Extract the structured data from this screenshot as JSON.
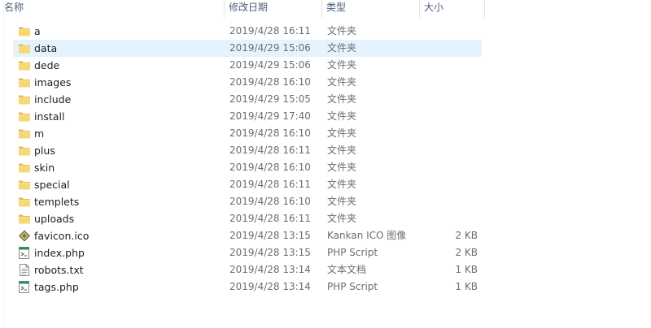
{
  "columns": {
    "name": "名称",
    "date": "修改日期",
    "type": "类型",
    "size": "大小"
  },
  "colors": {
    "selected_row": "#e5f3ff",
    "folder": "#f7d774",
    "header_text": "#4c607a"
  },
  "files": [
    {
      "name": "a",
      "date": "2019/4/28 16:11",
      "type": "文件夹",
      "size": "",
      "icon": "folder-icon"
    },
    {
      "name": "data",
      "date": "2019/4/29 15:06",
      "type": "文件夹",
      "size": "",
      "icon": "folder-icon",
      "selected": true
    },
    {
      "name": "dede",
      "date": "2019/4/29 15:06",
      "type": "文件夹",
      "size": "",
      "icon": "folder-icon"
    },
    {
      "name": "images",
      "date": "2019/4/28 16:10",
      "type": "文件夹",
      "size": "",
      "icon": "folder-icon"
    },
    {
      "name": "include",
      "date": "2019/4/29 15:05",
      "type": "文件夹",
      "size": "",
      "icon": "folder-icon"
    },
    {
      "name": "install",
      "date": "2019/4/29 17:40",
      "type": "文件夹",
      "size": "",
      "icon": "folder-icon"
    },
    {
      "name": "m",
      "date": "2019/4/28 16:10",
      "type": "文件夹",
      "size": "",
      "icon": "folder-icon"
    },
    {
      "name": "plus",
      "date": "2019/4/28 16:11",
      "type": "文件夹",
      "size": "",
      "icon": "folder-icon"
    },
    {
      "name": "skin",
      "date": "2019/4/28 16:10",
      "type": "文件夹",
      "size": "",
      "icon": "folder-icon"
    },
    {
      "name": "special",
      "date": "2019/4/28 16:11",
      "type": "文件夹",
      "size": "",
      "icon": "folder-icon"
    },
    {
      "name": "templets",
      "date": "2019/4/28 16:10",
      "type": "文件夹",
      "size": "",
      "icon": "folder-icon"
    },
    {
      "name": "uploads",
      "date": "2019/4/28 16:11",
      "type": "文件夹",
      "size": "",
      "icon": "folder-icon"
    },
    {
      "name": "favicon.ico",
      "date": "2019/4/28 13:15",
      "type": "Kankan ICO 图像",
      "size": "2 KB",
      "icon": "ico-file-icon"
    },
    {
      "name": "index.php",
      "date": "2019/4/28 13:15",
      "type": "PHP Script",
      "size": "2 KB",
      "icon": "php-file-icon"
    },
    {
      "name": "robots.txt",
      "date": "2019/4/28 13:14",
      "type": "文本文档",
      "size": "1 KB",
      "icon": "text-file-icon"
    },
    {
      "name": "tags.php",
      "date": "2019/4/28 13:14",
      "type": "PHP Script",
      "size": "1 KB",
      "icon": "php-file-icon"
    }
  ]
}
